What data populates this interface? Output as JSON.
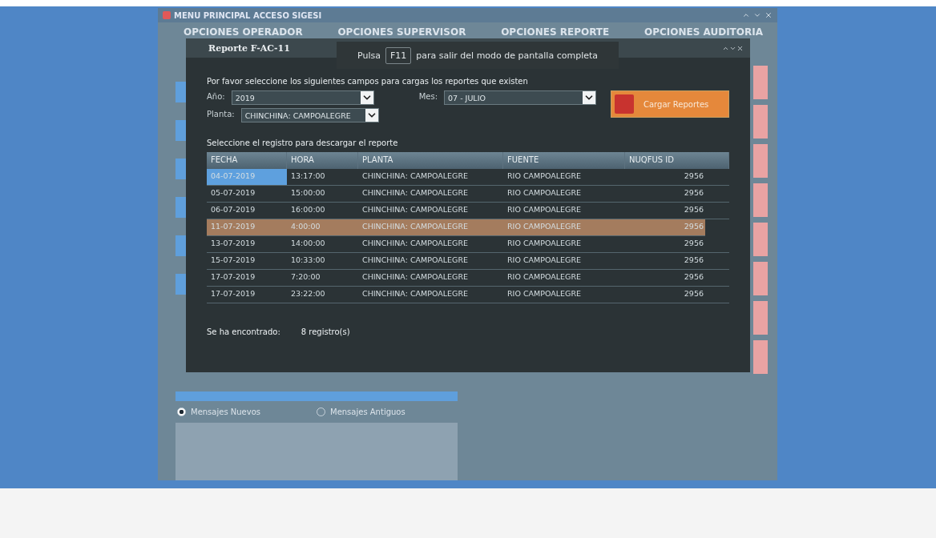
{
  "main_window": {
    "title": "MENU PRINCIPAL ACCESO SIGESI",
    "tabs": [
      {
        "label": "OPCIONES OPERADOR"
      },
      {
        "label": "OPCIONES SUPERVISOR"
      },
      {
        "label": "OPCIONES REPORTE"
      },
      {
        "label": "OPCIONES AUDITORIA"
      }
    ],
    "radios": [
      {
        "label": "Mensajes Nuevos",
        "selected": true
      },
      {
        "label": "Mensajes Antiguos",
        "selected": false
      }
    ]
  },
  "dialog": {
    "title": "Reporte F-AC-11",
    "instructions": "Por favor seleccione los siguientes campos para cargas los reportes que existen",
    "fields": [
      {
        "label": "Año:",
        "value": "2019"
      },
      {
        "label": "Mes:",
        "value": "07 - JULIO"
      },
      {
        "label": "Planta:",
        "value": "CHINCHINA: CAMPOALEGRE"
      }
    ],
    "load_button": "Cargar Reportes",
    "table_caption": "Seleccione el registro para descargar el reporte",
    "table": {
      "columns": [
        "FECHA",
        "HORA",
        "PLANTA",
        "FUENTE",
        "NUQFUS ID"
      ],
      "rows": [
        {
          "cells": [
            "04-07-2019",
            "13:17:00",
            "CHINCHINA: CAMPOALEGRE",
            "RIO CAMPOALEGRE",
            "2956"
          ],
          "selected": false,
          "focused": true
        },
        {
          "cells": [
            "05-07-2019",
            "15:00:00",
            "CHINCHINA: CAMPOALEGRE",
            "RIO CAMPOALEGRE",
            "2956"
          ],
          "selected": false,
          "focused": false
        },
        {
          "cells": [
            "06-07-2019",
            "16:00:00",
            "CHINCHINA: CAMPOALEGRE",
            "RIO CAMPOALEGRE",
            "2956"
          ],
          "selected": false,
          "focused": false
        },
        {
          "cells": [
            "11-07-2019",
            "4:00:00",
            "CHINCHINA: CAMPOALEGRE",
            "RIO CAMPOALEGRE",
            "2956"
          ],
          "selected": true,
          "focused": false
        },
        {
          "cells": [
            "13-07-2019",
            "14:00:00",
            "CHINCHINA: CAMPOALEGRE",
            "RIO CAMPOALEGRE",
            "2956"
          ],
          "selected": false,
          "focused": false
        },
        {
          "cells": [
            "15-07-2019",
            "10:33:00",
            "CHINCHINA: CAMPOALEGRE",
            "RIO CAMPOALEGRE",
            "2956"
          ],
          "selected": false,
          "focused": false
        },
        {
          "cells": [
            "17-07-2019",
            "7:20:00",
            "CHINCHINA: CAMPOALEGRE",
            "RIO CAMPOALEGRE",
            "2956"
          ],
          "selected": false,
          "focused": false
        },
        {
          "cells": [
            "17-07-2019",
            "23:22:00",
            "CHINCHINA: CAMPOALEGRE",
            "RIO CAMPOALEGRE",
            "2956"
          ],
          "selected": false,
          "focused": false
        }
      ]
    },
    "footer_label": "Se ha encontrado:",
    "footer_count": "8 registro(s)"
  },
  "fullscreen_notice": {
    "before": "Pulsa",
    "key": "F11",
    "after": "para salir del modo de pantalla completa"
  }
}
